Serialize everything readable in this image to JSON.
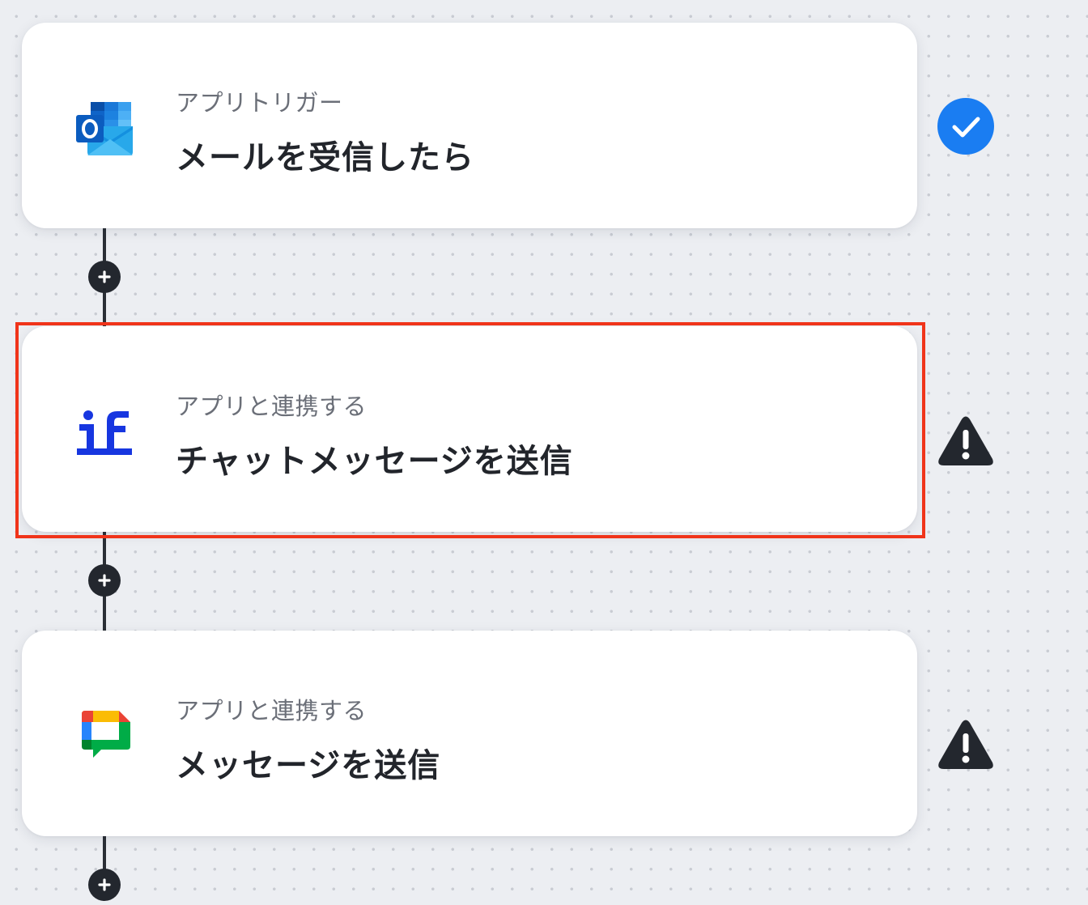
{
  "colors": {
    "success": "#1a7df2",
    "warning": "#23272e",
    "highlight": "#f0341a",
    "connector": "#2b2f36"
  },
  "steps": [
    {
      "type_label": "アプリトリガー",
      "title": "メールを受信したら",
      "icon": "outlook-icon",
      "status": "check-circle-icon"
    },
    {
      "type_label": "アプリと連携する",
      "title": "チャットメッセージを送信",
      "icon": "if-app-icon",
      "status": "warning-triangle-icon",
      "highlighted": true
    },
    {
      "type_label": "アプリと連携する",
      "title": "メッセージを送信",
      "icon": "google-chat-icon",
      "status": "warning-triangle-icon"
    }
  ],
  "add_buttons": [
    "plus-icon",
    "plus-icon",
    "plus-icon"
  ]
}
